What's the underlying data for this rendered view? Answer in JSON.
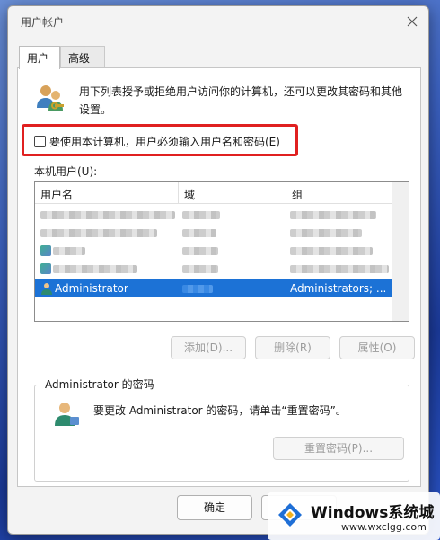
{
  "window": {
    "title": "用户帐户"
  },
  "tabs": [
    {
      "label": "用户"
    },
    {
      "label": "高级"
    }
  ],
  "intro": {
    "text": "用下列表授予或拒绝用户访问你的计算机，还可以更改其密码和其他设置。"
  },
  "require_login": {
    "label": "要使用本计算机，用户必须输入用户名和密码(E)",
    "checked": false
  },
  "users": {
    "label": "本机用户(U):",
    "columns": [
      "用户名",
      "域",
      "组"
    ],
    "selected_row": {
      "name": "Administrator",
      "group": "Administrators; ..."
    }
  },
  "buttons": {
    "add": "添加(D)...",
    "remove": "删除(R)",
    "properties": "属性(O)"
  },
  "password_group": {
    "title": "Administrator 的密码",
    "text": "要更改 Administrator 的密码，请单击“重置密码”。",
    "reset_button": "重置密码(P)..."
  },
  "dialog_buttons": {
    "ok": "确定"
  },
  "watermark": {
    "title": "Windows系统城",
    "url": "www.wxclgg.com"
  },
  "colors": {
    "selection": "#1c72d6",
    "highlight_border": "#e02020",
    "accent": "#2b55c8"
  }
}
